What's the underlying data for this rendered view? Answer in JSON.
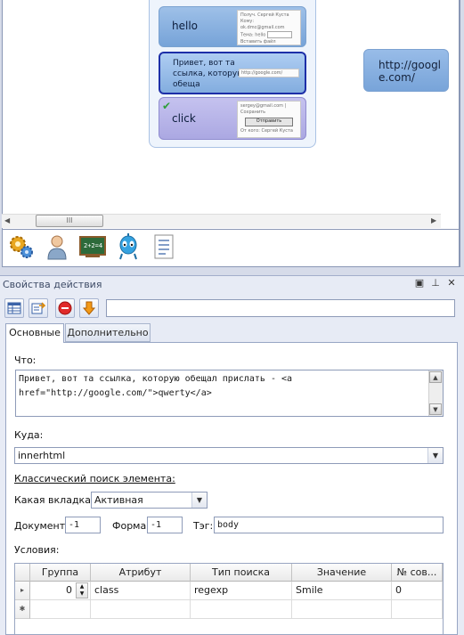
{
  "canvas": {
    "cards": [
      {
        "label": "hello",
        "style": "blue",
        "thumb": {
          "line1": "Получ. Сергей Куста",
          "line2": "Кому: ok.dmc@gmail.com",
          "line3": "Тема: hello",
          "line4": "Вставить файл"
        }
      },
      {
        "label": "Привет, вот та ссылка, которую обеща",
        "style": "selected",
        "thumb": {
          "line1": "http://google.com/"
        }
      },
      {
        "label": "click",
        "style": "purple",
        "check_icon": "check-icon",
        "thumb": {
          "line1": "sergey@gmail.com | Сохранить",
          "button": "Отправить",
          "line3": "От кого: Сергей Куста"
        }
      }
    ],
    "far_card": {
      "text": "http://google.com/"
    }
  },
  "app_toolbar": {
    "icons": [
      "gears-icon",
      "user-icon",
      "chalkboard-icon",
      "alien-icon",
      "list-document-icon"
    ]
  },
  "panel": {
    "title": "Свойства действия",
    "window_buttons": [
      "restore-icon",
      "pin-icon",
      "close-icon"
    ],
    "toolbar_icons": [
      "table-icon",
      "export-icon",
      "stop-icon",
      "download-arrow-icon"
    ],
    "action_name": "",
    "tabs": [
      {
        "label": "Основные",
        "active": true
      },
      {
        "label": "Дополнительно",
        "active": false
      }
    ],
    "what_label": "Что:",
    "what_value": "Привет, вот та ссылка, которую обещал прислать - <a href=\"http://google.com/\">qwerty</a>",
    "where_label": "Куда:",
    "where_value": "innerhtml",
    "classic_search_label": "Классический поиск элемента:",
    "tab_label": "Какая вкладка:",
    "tab_value": "Активная",
    "document_label": "Документ:",
    "document_value": "-1",
    "form_label": "Форма:",
    "form_value": "-1",
    "tag_label": "Тэг:",
    "tag_value": "body",
    "conditions_label": "Условия:",
    "grid": {
      "columns": [
        "Группа",
        "Атрибут",
        "Тип поиска",
        "Значение",
        "№ сов..."
      ],
      "rows": [
        {
          "group": "0",
          "attribute": "class",
          "search_type": "regexp",
          "value": "Smile",
          "match_no": "0"
        }
      ],
      "new_row_marker": "✱",
      "current_row_marker": "▸"
    }
  },
  "colors": {
    "accent": "#1d2fa8",
    "card_blue": "#8fb6e4",
    "card_purple": "#b8b5ea",
    "panel_bg": "#e7ebf5"
  }
}
